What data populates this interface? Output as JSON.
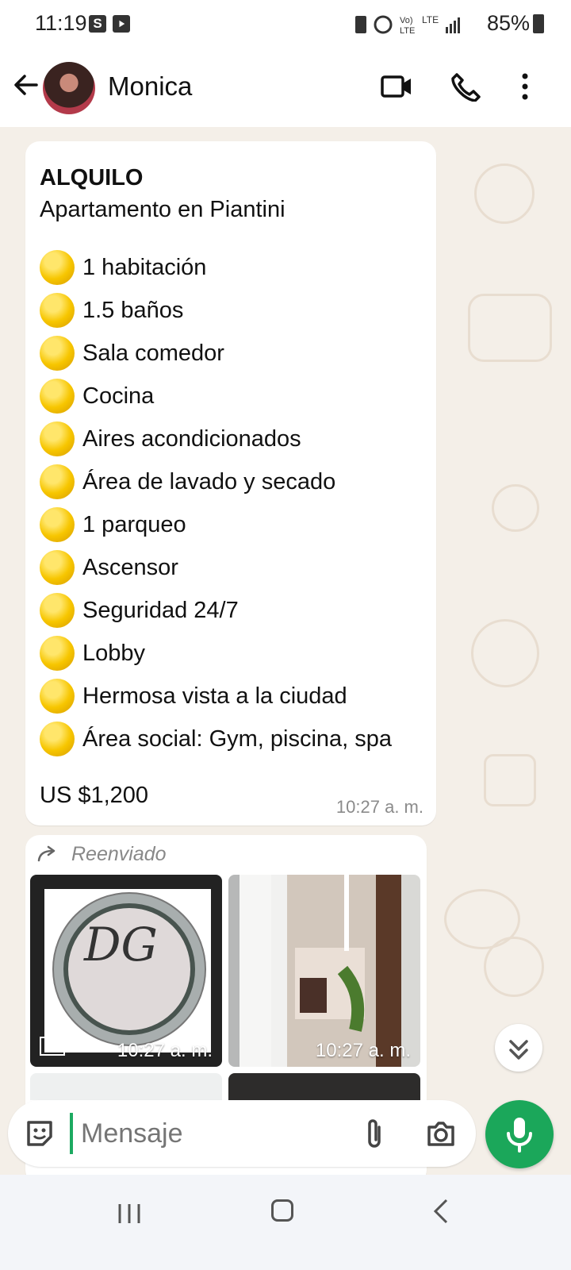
{
  "status_bar": {
    "time": "11:19",
    "badge_s": "S",
    "battery": "85%",
    "icons": [
      "s-app-icon",
      "youtube-icon",
      "nfc-icon",
      "alarm-icon",
      "volte-icon",
      "lte-icon",
      "signal-icon",
      "battery-icon"
    ]
  },
  "header": {
    "contact_name": "Monica",
    "icons": [
      "back-icon",
      "avatar",
      "video-call-icon",
      "voice-call-icon",
      "menu-icon"
    ]
  },
  "message": {
    "title": "ALQUILO",
    "subtitle": "Apartamento en Piantini",
    "features": [
      "1 habitación",
      "1.5 baños",
      " Sala comedor",
      "Cocina",
      "Aires acondicionados",
      "Área de lavado y secado",
      "1 parqueo",
      "Ascensor",
      "Seguridad 24/7",
      "Lobby",
      "Hermosa vista a la ciudad",
      "Área social: Gym, piscina, spa"
    ],
    "price": "US $1,200",
    "time": "10:27 a. m."
  },
  "forwarded": {
    "label": "Reenviado",
    "logo_text": "DG",
    "images": [
      {
        "time": "10:27 a. m.",
        "hd": "HD"
      },
      {
        "time": "10:27 a. m."
      }
    ]
  },
  "composer": {
    "placeholder": "Mensaje"
  },
  "colors": {
    "accent_green": "#1ba75a",
    "chat_background": "#f4efe8"
  }
}
